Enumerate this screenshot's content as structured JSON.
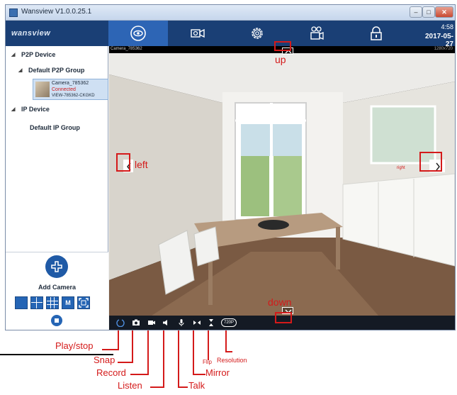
{
  "window": {
    "title": "Wansview  V1.0.0.25.1",
    "controls": {
      "minimize": "–",
      "maximize": "□",
      "close": "✕"
    }
  },
  "topnav": {
    "logo": "wansview",
    "tabs": [
      {
        "name": "live-view",
        "icon": "eye-icon",
        "active": true
      },
      {
        "name": "playback",
        "icon": "video-playback-icon",
        "active": false
      },
      {
        "name": "settings",
        "icon": "gear-icon",
        "active": false
      },
      {
        "name": "recording",
        "icon": "camera-film-icon",
        "active": false
      },
      {
        "name": "lock",
        "icon": "lock-icon",
        "active": false
      }
    ],
    "time": "4:58",
    "date": "2017-05-27"
  },
  "sidebar": {
    "p2p_device": "P2P Device",
    "default_p2p_group": "Default P2P Group",
    "camera": {
      "name": "Camera_785362",
      "status": "Connected",
      "id": "VIEW-785362-CKGKD"
    },
    "ip_device": "IP Device",
    "default_ip_group": "Default IP Group",
    "add_camera": "Add Camera",
    "layout_m": "M"
  },
  "video": {
    "camera_label": "Camera_785362",
    "resolution_readout": "1280x720"
  },
  "toolbar": {
    "resolution_badge": "720P"
  },
  "annotations": {
    "up": "up",
    "down": "down",
    "left": "left",
    "right": "right",
    "play_stop": "Play/stop",
    "snap": "Snap",
    "record": "Record",
    "listen": "Listen",
    "talk": "Talk",
    "mirror": "Mirror",
    "flip": "Flip",
    "resolution": "Resolution"
  },
  "colors": {
    "nav_bg": "#1a3f75",
    "nav_active": "#2d65b5",
    "annotation_red": "#d41a1a",
    "connected_red": "#d01c1c"
  }
}
